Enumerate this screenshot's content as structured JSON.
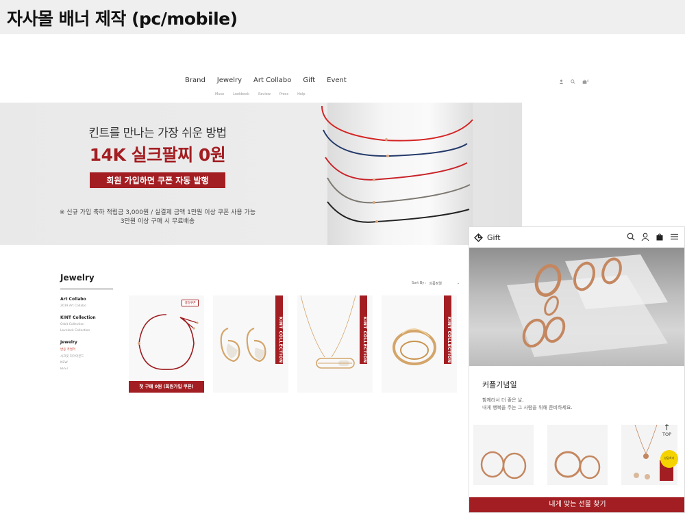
{
  "page_title": "자사몰 배너 제작 (pc/mobile)",
  "pc": {
    "nav": {
      "items": [
        "Brand",
        "Jewelry",
        "Art Collabo",
        "Gift",
        "Event"
      ],
      "subitems": [
        "Muse",
        "Lookbook",
        "Review",
        "Press",
        "Help"
      ],
      "cart_count": "0"
    },
    "hero": {
      "subtitle": "킨트를 만나는 가장 쉬운 방법",
      "headline": "14K 실크팔찌 0원",
      "badge": "회원 가입하면 쿠폰 자동 발행",
      "note_line1": "※ 신규 가입 축하 적립금 3,000원 / 실결제 금액 1만원 이상 쿠폰 사용 가능",
      "note_line2": "3만원 이상 구매 시 무료배송"
    },
    "section": {
      "title": "Jewelry",
      "sort_label": "Sort By :",
      "sort_value": "상품정렬"
    },
    "sidebar": {
      "groups": [
        {
          "head": "Art Collabo",
          "items": [
            "2019 Art Collabo"
          ]
        },
        {
          "head": "KINT Collection",
          "items": [
            "Orbit Collection",
            "Lovelock Collection"
          ]
        },
        {
          "head": "Jewelry",
          "items": [
            "반응 주얼리",
            "시크릿 다이아몬드",
            "NEW",
            "BEST"
          ]
        }
      ]
    },
    "products": [
      {
        "tag": "생일쿠폰",
        "cta": "첫 구매 0원 (회원가입 쿠폰)"
      },
      {
        "band": "KINT COLLECTION"
      },
      {
        "band": "KINT COLLECTION"
      },
      {
        "band": "KINT COLLECTION"
      }
    ]
  },
  "mobile": {
    "logo": "Gift",
    "category_title": "커플기념일",
    "desc_line1": "함께라서 더 좋은 날,",
    "desc_line2": "내게 행복을 주는 그 사람을 위해 준비하세요.",
    "top_label": "TOP",
    "chat_label": "상담하기",
    "bottom_cta": "내게 맞는 선물 찾기"
  },
  "colors": {
    "accent": "#a31e22",
    "title_bar": "#efefef"
  }
}
